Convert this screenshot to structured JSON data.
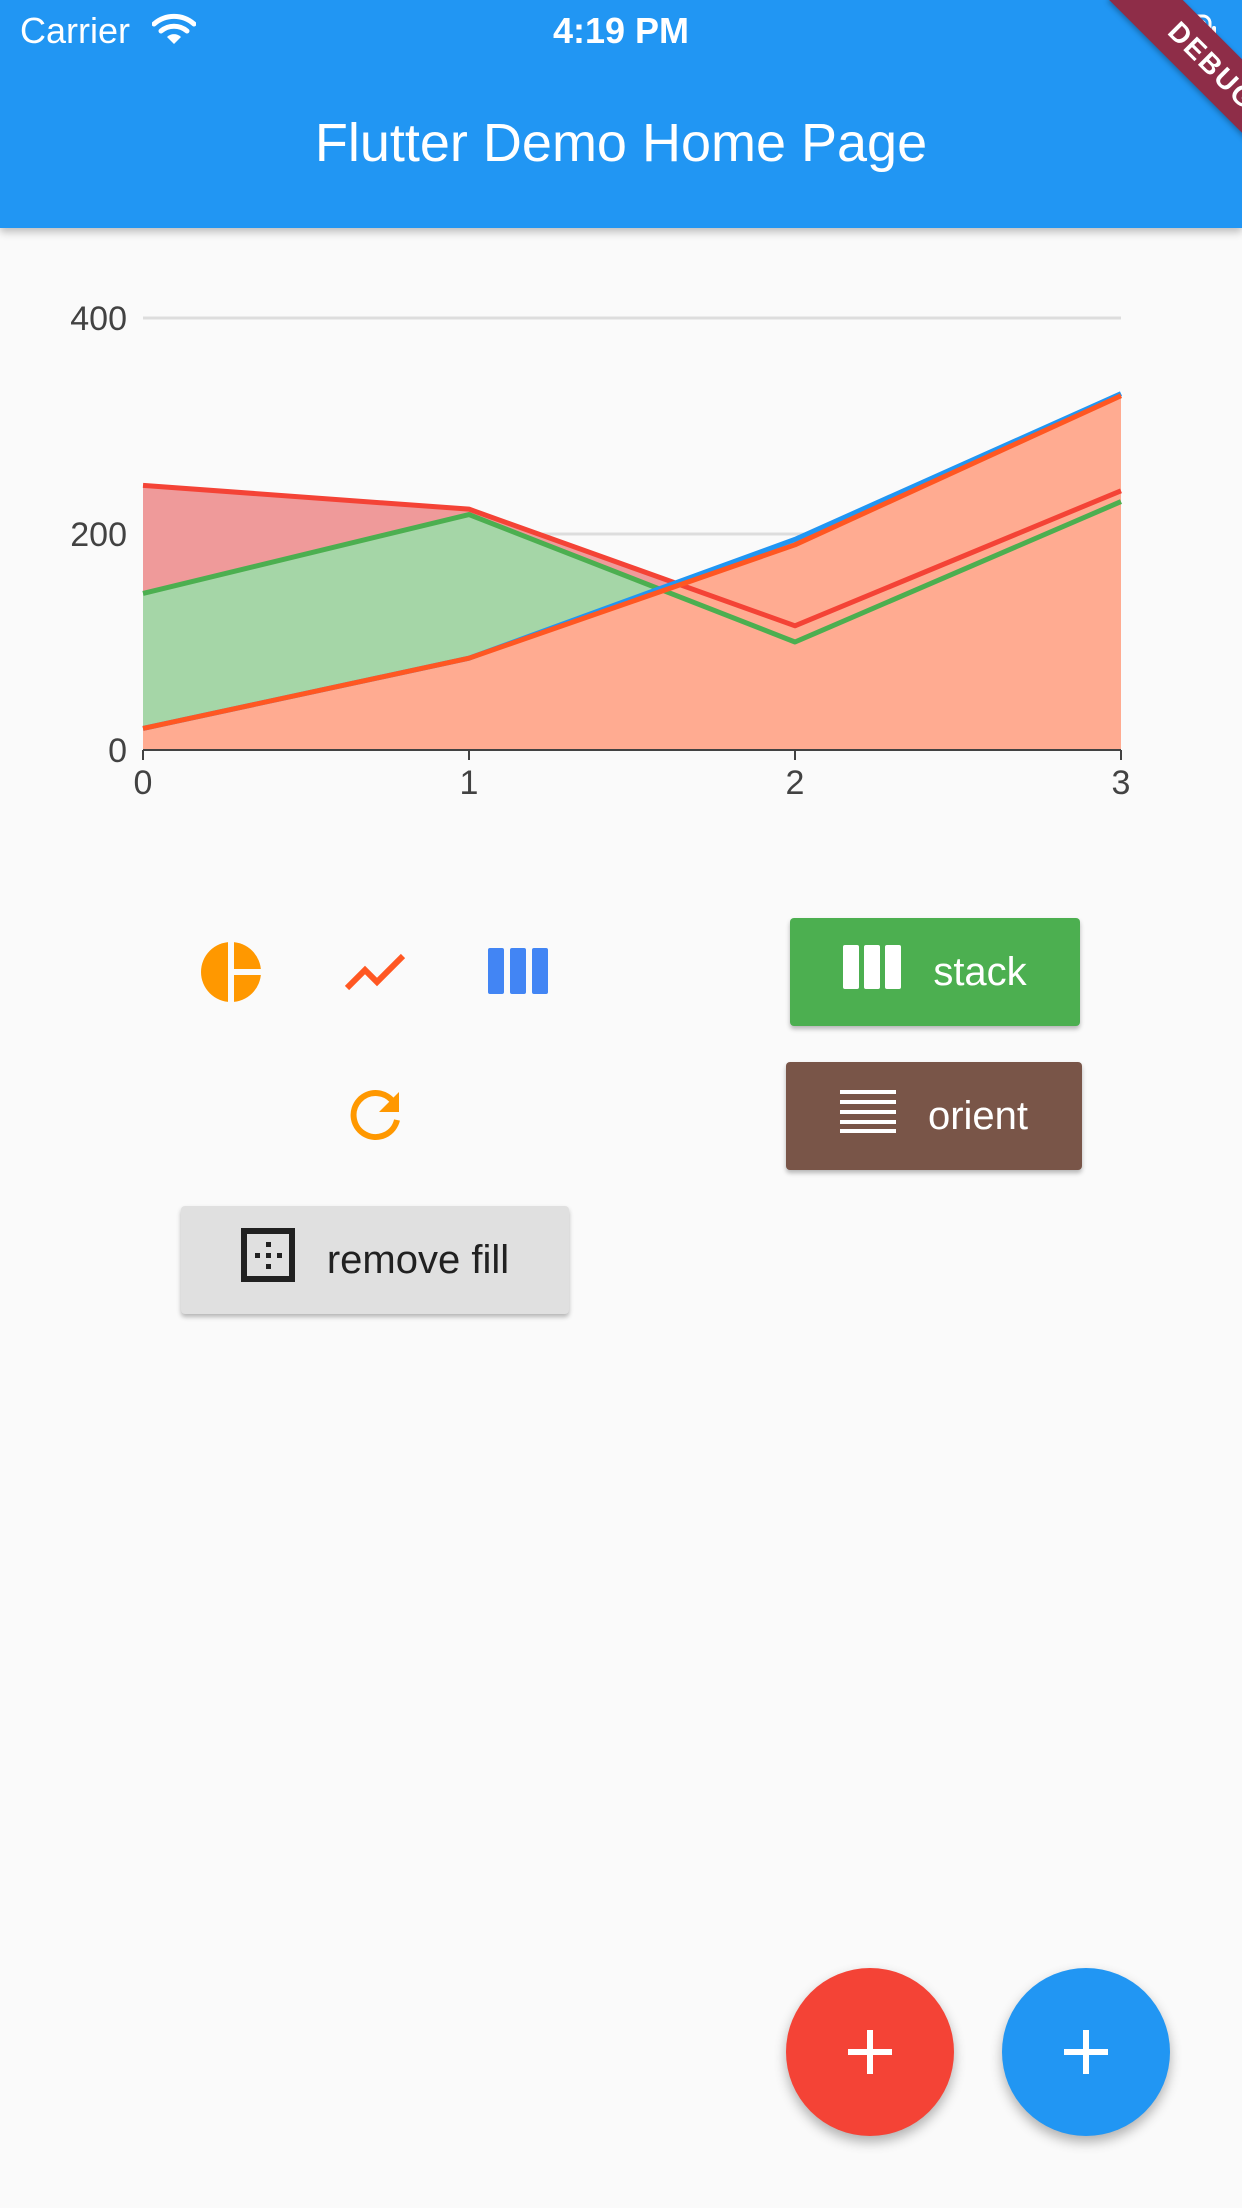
{
  "status_bar": {
    "carrier": "Carrier",
    "time": "4:19 PM"
  },
  "app_bar": {
    "title": "Flutter Demo Home Page",
    "color": "#2196f3"
  },
  "debug_banner": "DEBUG",
  "chart_data": {
    "type": "area",
    "x": [
      0,
      1,
      2,
      3
    ],
    "x_ticks": [
      "0",
      "1",
      "2",
      "3"
    ],
    "y_ticks": [
      "0",
      "200",
      "400"
    ],
    "ylim": [
      0,
      400
    ],
    "grid": true,
    "series": [
      {
        "values": [
          245,
          223,
          115,
          240
        ],
        "color": "#f44336",
        "fill": "#ef9a9a"
      },
      {
        "values": [
          145,
          218,
          100,
          230
        ],
        "color": "#4caf50",
        "fill": "#a5d6a7"
      },
      {
        "values": [
          20,
          85,
          195,
          330
        ],
        "color": "#2196f3",
        "fill": "#90caf9"
      },
      {
        "values": [
          20,
          85,
          190,
          328
        ],
        "color": "#ff5722",
        "fill": "#ffab91"
      }
    ]
  },
  "controls": {
    "stack_label": "stack",
    "orient_label": "orient",
    "remove_fill_label": "remove fill",
    "colors": {
      "pie": "#ff9800",
      "line": "#ff5722",
      "bar": "#4285f4",
      "refresh": "#ff9800",
      "stack_bg": "#4caf50",
      "orient_bg": "#795548",
      "remove_fill_bg": "#e0e0e0"
    }
  },
  "fabs": [
    {
      "icon": "plus-icon",
      "color": "#f44336"
    },
    {
      "icon": "plus-icon",
      "color": "#2196f3"
    }
  ]
}
